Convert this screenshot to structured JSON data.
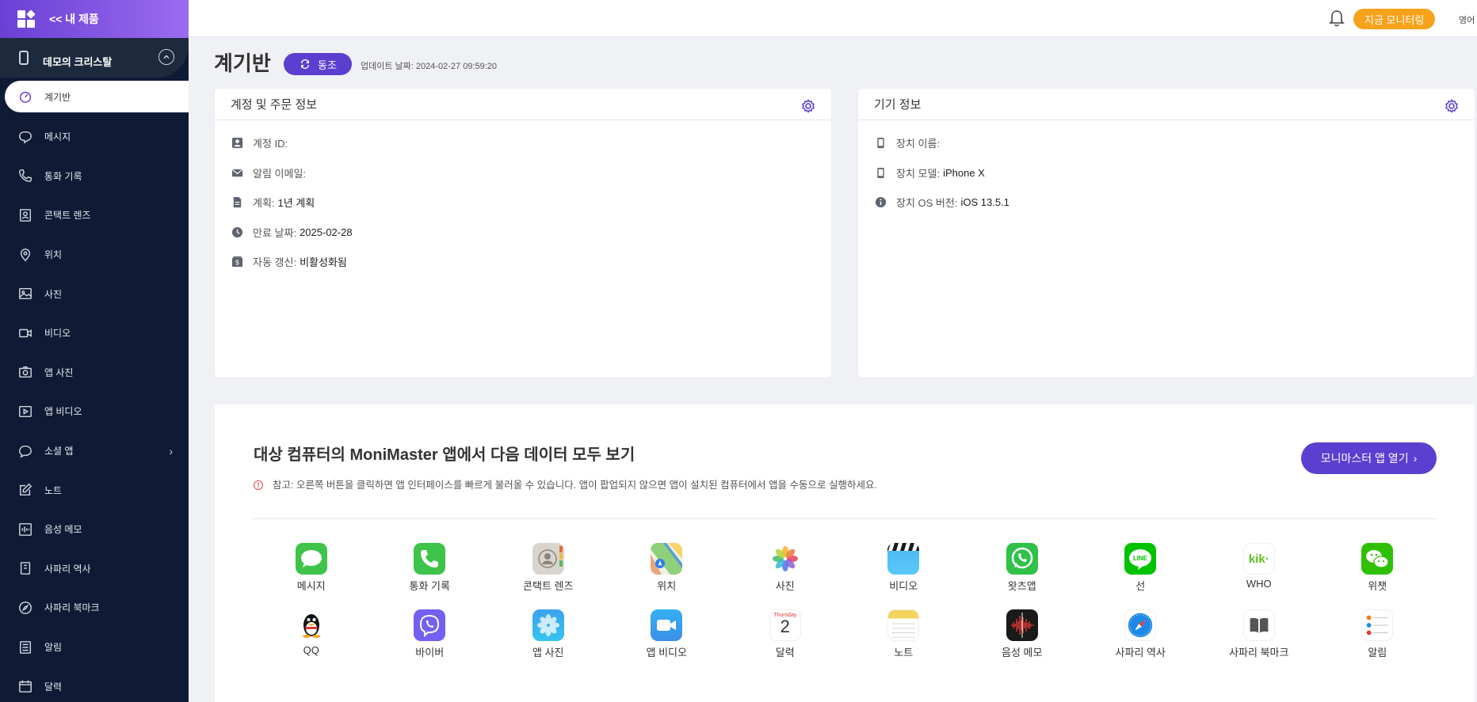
{
  "sidebar": {
    "back_label": "<< 내 제품",
    "device_name": "데모의 크리스탈",
    "items": [
      {
        "label": "계기반",
        "icon": "dashboard-icon"
      },
      {
        "label": "메시지",
        "icon": "chat-icon"
      },
      {
        "label": "통화 기록",
        "icon": "phone-icon"
      },
      {
        "label": "콘택트 렌즈",
        "icon": "contact-icon"
      },
      {
        "label": "위치",
        "icon": "location-icon"
      },
      {
        "label": "사진",
        "icon": "photo-icon"
      },
      {
        "label": "비디오",
        "icon": "video-icon"
      },
      {
        "label": "앱 사진",
        "icon": "camera-icon"
      },
      {
        "label": "앱 비디오",
        "icon": "play-icon"
      },
      {
        "label": "소셜 앱",
        "icon": "social-icon"
      },
      {
        "label": "노트",
        "icon": "note-icon"
      },
      {
        "label": "음성 메모",
        "icon": "voice-icon"
      },
      {
        "label": "사파리 역사",
        "icon": "bookmark-icon"
      },
      {
        "label": "사파리 북마크",
        "icon": "compass-icon"
      },
      {
        "label": "알림",
        "icon": "list-icon"
      },
      {
        "label": "달력",
        "icon": "calendar-icon"
      }
    ]
  },
  "header": {
    "monitor_button": "지금 모니터링",
    "language": "영어"
  },
  "title": {
    "page_title": "계기반",
    "sync_label": "동조",
    "updated": "업데이트 날짜: 2024-02-27 09:59:20"
  },
  "account_card": {
    "title": "계정 및 주문 정보",
    "rows": [
      {
        "label": "계정 ID:",
        "value": ""
      },
      {
        "label": "알림 이메일:",
        "value": ""
      },
      {
        "label": "계획:",
        "value": "1년 계획"
      },
      {
        "label": "만료 날짜:",
        "value": "2025-02-28"
      },
      {
        "label": "자동 갱신:",
        "value": "비활성화됨"
      }
    ]
  },
  "device_card": {
    "title": "기기 정보",
    "rows": [
      {
        "label": "장치 이름:",
        "value": ""
      },
      {
        "label": "장치 모델:",
        "value": "iPhone X"
      },
      {
        "label": "장치 OS 버전:",
        "value": "iOS 13.5.1"
      }
    ]
  },
  "panel": {
    "title": "대상 컴퓨터의 MoniMaster 앱에서 다음 데이터 모두 보기",
    "open_button": "모니마스터 앱 열기",
    "note": "참고: 오른쪽 버튼을 클릭하면 앱 인터페이스를 빠르게 불러올 수 있습니다. 앱이 팝업되지 않으면 앱이 설치된 컴퓨터에서 앱을 수동으로 실행하세요.",
    "apps": [
      {
        "label": "메시지",
        "icon": "messages-app-icon",
        "color": "#3ec44a"
      },
      {
        "label": "통화 기록",
        "icon": "phone-app-icon",
        "color": "#3ec44a"
      },
      {
        "label": "콘택트 렌즈",
        "icon": "contacts-app-icon",
        "color": "#c9c4bd"
      },
      {
        "label": "위치",
        "icon": "maps-app-icon",
        "color": "#8fd07a"
      },
      {
        "label": "사진",
        "icon": "photos-app-icon",
        "color": "#ffffff"
      },
      {
        "label": "비디오",
        "icon": "clapper-app-icon",
        "color": "#5ac8fa"
      },
      {
        "label": "왓츠앱",
        "icon": "whatsapp-app-icon",
        "color": "#2fc148"
      },
      {
        "label": "선",
        "icon": "line-app-icon",
        "color": "#00c300"
      },
      {
        "label": "WHO",
        "icon": "kik-app-icon",
        "color": "#ffffff"
      },
      {
        "label": "위챗",
        "icon": "wechat-app-icon",
        "color": "#2dc100"
      },
      {
        "label": "QQ",
        "icon": "qq-app-icon",
        "color": "#ffffff"
      },
      {
        "label": "바이버",
        "icon": "viber-app-icon",
        "color": "#7360f2"
      },
      {
        "label": "앱 사진",
        "icon": "app-photo-icon",
        "color": "#36a8f0"
      },
      {
        "label": "앱 비디오",
        "icon": "facetime-app-icon",
        "color": "#3ba3ef"
      },
      {
        "label": "달력",
        "icon": "calendar-app-icon",
        "color": "#ffffff"
      },
      {
        "label": "노트",
        "icon": "notes-app-icon",
        "color": "#f4d35e"
      },
      {
        "label": "음성 메모",
        "icon": "voice-memo-app-icon",
        "color": "#1a1a1a"
      },
      {
        "label": "사파리 역사",
        "icon": "safari-app-icon",
        "color": "#1e88e5"
      },
      {
        "label": "사파리 북마크",
        "icon": "books-app-icon",
        "color": "#ffffff"
      },
      {
        "label": "알림",
        "icon": "reminders-app-icon",
        "color": "#ffffff"
      }
    ],
    "calendar_day": "Thursday",
    "calendar_date": "2",
    "kik_text": "kik·",
    "line_text": "LINE"
  },
  "colors": {
    "accent": "#5b3fd0",
    "orange": "#f7a21b",
    "sidebar_bg": "#0f1b35"
  }
}
